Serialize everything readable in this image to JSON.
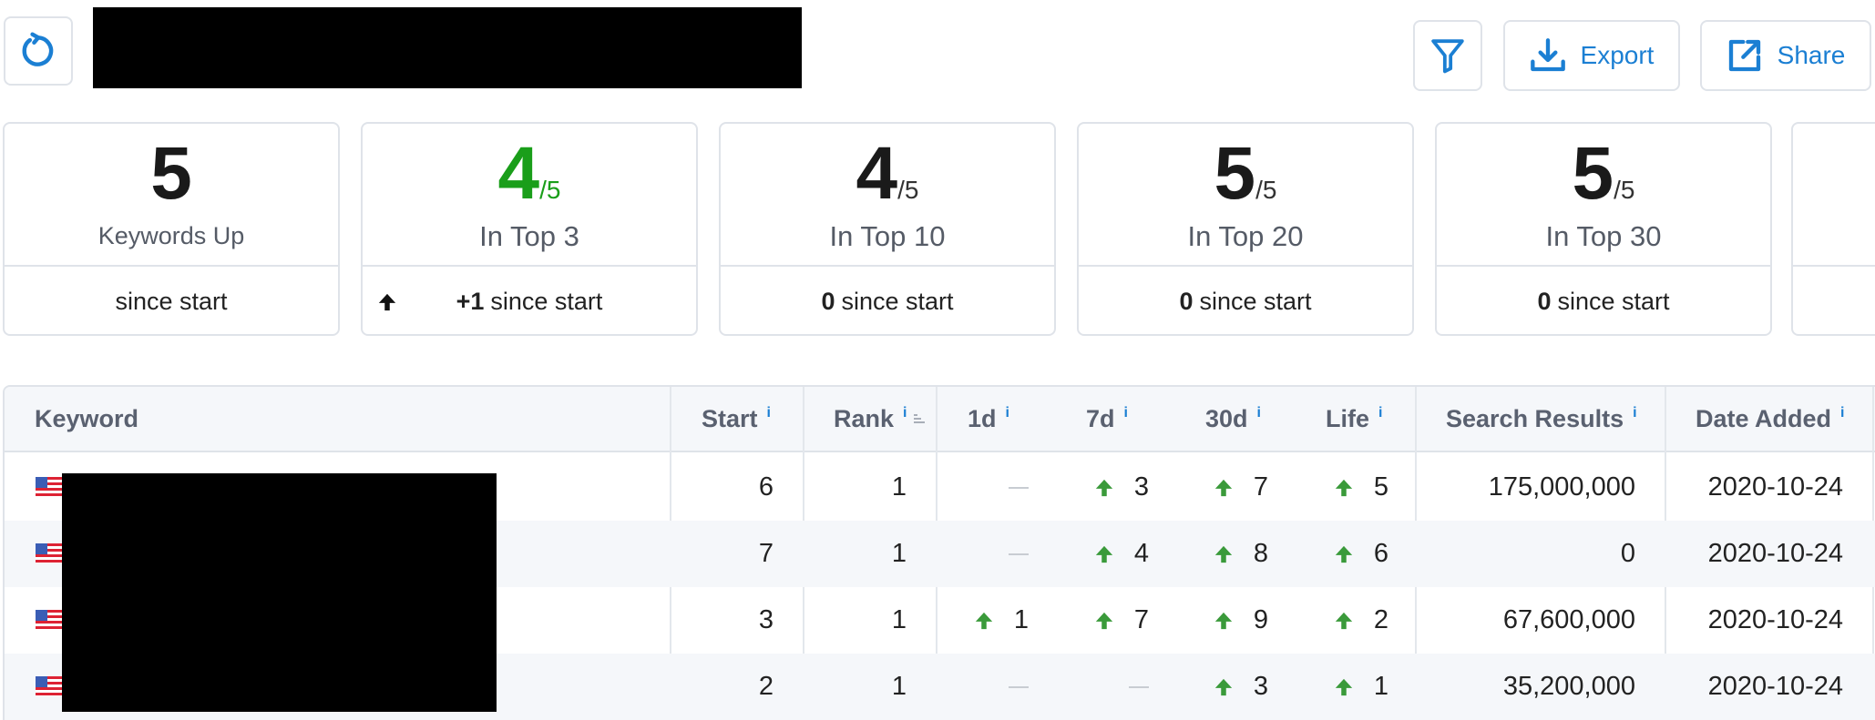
{
  "header": {
    "export_label": "Export",
    "share_label": "Share"
  },
  "stats": [
    {
      "value": "5",
      "denominator": "",
      "label": "Keywords Up",
      "change": "",
      "since": "since start",
      "highlight": false
    },
    {
      "value": "4",
      "denominator": "/5",
      "label": "In Top 3",
      "change": "+1",
      "since": "since start",
      "highlight": true
    },
    {
      "value": "4",
      "denominator": "/5",
      "label": "In Top 10",
      "change": "0",
      "since": "since start",
      "highlight": false
    },
    {
      "value": "5",
      "denominator": "/5",
      "label": "In Top 20",
      "change": "0",
      "since": "since start",
      "highlight": false
    },
    {
      "value": "5",
      "denominator": "/5",
      "label": "In Top 30",
      "change": "0",
      "since": "since start",
      "highlight": false
    }
  ],
  "table": {
    "columns": {
      "keyword": "Keyword",
      "start": "Start",
      "rank": "Rank",
      "d1": "1d",
      "d7": "7d",
      "d30": "30d",
      "life": "Life",
      "search_results": "Search Results",
      "date_added": "Date Added",
      "info_glyph": "i"
    },
    "rows": [
      {
        "start": "6",
        "rank": "1",
        "d1": "",
        "d7": "3",
        "d30": "7",
        "life": "5",
        "search_results": "175,000,000",
        "date_added": "2020-10-24"
      },
      {
        "start": "7",
        "rank": "1",
        "d1": "",
        "d7": "4",
        "d30": "8",
        "life": "6",
        "search_results": "0",
        "date_added": "2020-10-24"
      },
      {
        "start": "3",
        "rank": "1",
        "d1": "1",
        "d7": "7",
        "d30": "9",
        "life": "2",
        "search_results": "67,600,000",
        "date_added": "2020-10-24"
      },
      {
        "start": "2",
        "rank": "1",
        "d1": "",
        "d7": "",
        "d30": "3",
        "life": "1",
        "search_results": "35,200,000",
        "date_added": "2020-10-24"
      }
    ]
  },
  "colors": {
    "accent": "#1b7fd3",
    "up_green": "#3a9a3a",
    "highlight_green": "#1a9e1a",
    "border": "#dfe3e9"
  }
}
